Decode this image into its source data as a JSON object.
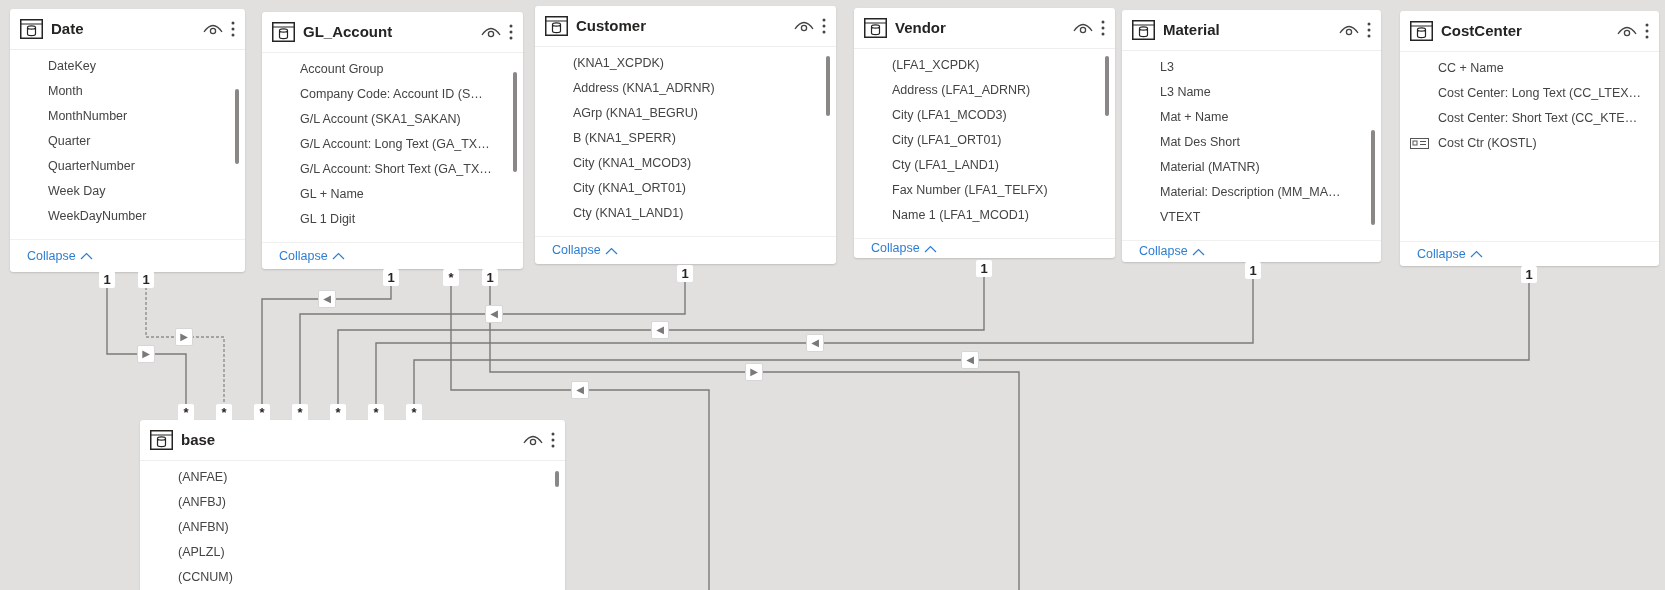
{
  "tables": [
    {
      "name": "Date",
      "fields": [
        {
          "label": "DateKey",
          "kind": "column"
        },
        {
          "label": "Month",
          "kind": "column"
        },
        {
          "label": "MonthNumber",
          "kind": "column"
        },
        {
          "label": "Quarter",
          "kind": "column"
        },
        {
          "label": "QuarterNumber",
          "kind": "column"
        },
        {
          "label": "Week Day",
          "kind": "column"
        },
        {
          "label": "WeekDayNumber",
          "kind": "column"
        }
      ],
      "collapse": "Collapse"
    },
    {
      "name": "GL_Account",
      "fields": [
        {
          "label": "Account Group",
          "kind": "column"
        },
        {
          "label": "Company Code: Account ID (S…",
          "kind": "column"
        },
        {
          "label": "G/L Account (SKA1_SAKAN)",
          "kind": "column"
        },
        {
          "label": "G/L Account: Long Text (GA_TX…",
          "kind": "column"
        },
        {
          "label": "G/L Account: Short Text (GA_TX…",
          "kind": "column"
        },
        {
          "label": "GL + Name",
          "kind": "column"
        },
        {
          "label": "GL 1 Digit",
          "kind": "column"
        }
      ],
      "collapse": "Collapse"
    },
    {
      "name": "Customer",
      "fields": [
        {
          "label": "(KNA1_XCPDK)",
          "kind": "column"
        },
        {
          "label": "Address (KNA1_ADRNR)",
          "kind": "column"
        },
        {
          "label": "AGrp (KNA1_BEGRU)",
          "kind": "column"
        },
        {
          "label": "B (KNA1_SPERR)",
          "kind": "column"
        },
        {
          "label": "City (KNA1_MCOD3)",
          "kind": "column"
        },
        {
          "label": "City (KNA1_ORT01)",
          "kind": "column"
        },
        {
          "label": "Cty (KNA1_LAND1)",
          "kind": "column"
        }
      ],
      "collapse": "Collapse"
    },
    {
      "name": "Vendor",
      "fields": [
        {
          "label": "(LFA1_XCPDK)",
          "kind": "column"
        },
        {
          "label": "Address (LFA1_ADRNR)",
          "kind": "column"
        },
        {
          "label": "City (LFA1_MCOD3)",
          "kind": "column"
        },
        {
          "label": "City (LFA1_ORT01)",
          "kind": "column"
        },
        {
          "label": "Cty (LFA1_LAND1)",
          "kind": "column"
        },
        {
          "label": "Fax Number (LFA1_TELFX)",
          "kind": "column"
        },
        {
          "label": "Name 1 (LFA1_MCOD1)",
          "kind": "column"
        }
      ],
      "collapse": "Collapse"
    },
    {
      "name": "Material",
      "fields": [
        {
          "label": "L3",
          "kind": "column"
        },
        {
          "label": "L3 Name",
          "kind": "column"
        },
        {
          "label": "Mat + Name",
          "kind": "column"
        },
        {
          "label": "Mat Des Short",
          "kind": "column"
        },
        {
          "label": "Material (MATNR)",
          "kind": "column"
        },
        {
          "label": "Material: Description (MM_MA…",
          "kind": "column"
        },
        {
          "label": "VTEXT",
          "kind": "column"
        }
      ],
      "collapse": "Collapse"
    },
    {
      "name": "CostCenter",
      "fields": [
        {
          "label": "CC + Name",
          "kind": "column"
        },
        {
          "label": "Cost Center: Long Text (CC_LTEX…",
          "kind": "column"
        },
        {
          "label": "Cost Center: Short Text (CC_KTE…",
          "kind": "column"
        },
        {
          "label": "Cost Ctr (KOSTL)",
          "kind": "key"
        }
      ],
      "collapse": "Collapse"
    },
    {
      "name": "base",
      "fields": [
        {
          "label": "(ANFAE)",
          "kind": "column"
        },
        {
          "label": "(ANFBJ)",
          "kind": "column"
        },
        {
          "label": "(ANFBN)",
          "kind": "column"
        },
        {
          "label": "(APLZL)",
          "kind": "column"
        },
        {
          "label": "(CCNUM)",
          "kind": "column"
        }
      ]
    }
  ],
  "relationships": [
    {
      "start": "1",
      "end": "*",
      "arrow": "▶",
      "active": true
    },
    {
      "start": "1",
      "end": "*",
      "arrow": "▶",
      "active": false
    },
    {
      "start": "1",
      "end": "*",
      "arrow": "◀",
      "active": true
    },
    {
      "start": "*",
      "arrow": "◀",
      "active": true
    },
    {
      "start": "1",
      "arrow": "▶",
      "active": true
    },
    {
      "start": "1",
      "end": "*",
      "arrow": "◀",
      "active": true
    },
    {
      "start": "1",
      "end": "*",
      "arrow": "◀",
      "active": true
    },
    {
      "start": "1",
      "end": "*",
      "arrow": "◀",
      "active": true
    },
    {
      "start": "1",
      "end": "*",
      "arrow": "◀",
      "active": true
    }
  ]
}
